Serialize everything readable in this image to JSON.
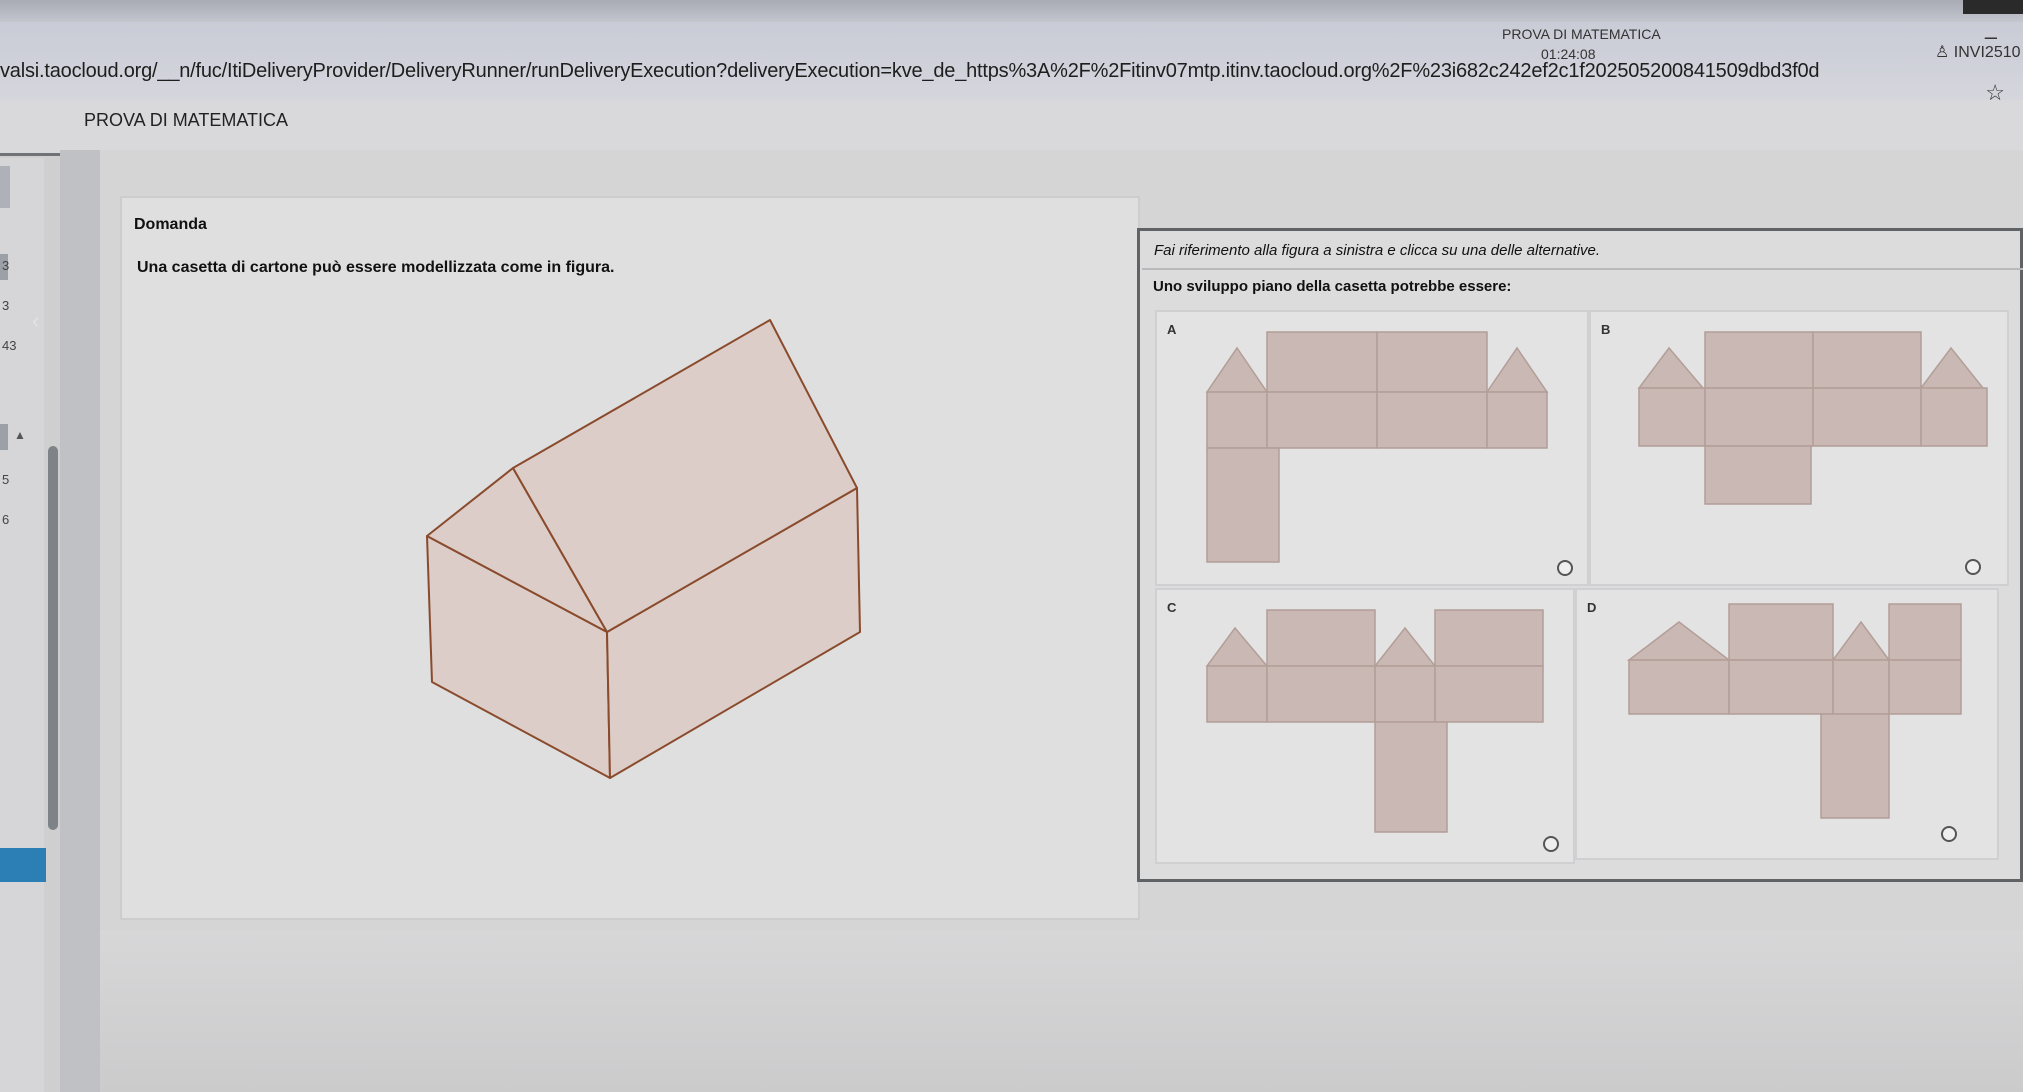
{
  "browser": {
    "url_part1": "valsi.taocloud.org/__n/fuc/ItiDeliveryProvider/DeliveryRunner/runDeliveryExecution?deliveryExecution=kve_de_https%3A%2F%2Fitinv07mtp.itinv.taocloud.org%2F%23i682c242ef2c1f202505200841509dbd3f0d",
    "min_glyph": "–",
    "star_glyph": "☆"
  },
  "header": {
    "app_title": "PROVA DI MATEMATICA",
    "test_title": "PROVA DI MATEMATICA",
    "timer": "01:24:08",
    "user_icon": "user-icon",
    "user_id": "INVI2510"
  },
  "sidebar": {
    "numbers": [
      "3",
      "3",
      "43",
      "5",
      "6"
    ],
    "collapse_glyph": "‹",
    "scroll_up_glyph": "▲"
  },
  "question": {
    "label": "Domanda",
    "text": "Una casetta di cartone può essere modellizzata come in figura."
  },
  "answers": {
    "instruction": "Fai riferimento alla figura a sinistra e clicca su una delle alternative.",
    "prompt": "Uno sviluppo piano della casetta potrebbe essere:",
    "options": [
      {
        "letter": "A"
      },
      {
        "letter": "B"
      },
      {
        "letter": "C"
      },
      {
        "letter": "D"
      }
    ]
  },
  "colors": {
    "face_fill": "#dccdc9",
    "net_fill": "#c9b8b3",
    "edge": "#8a4b2c"
  }
}
